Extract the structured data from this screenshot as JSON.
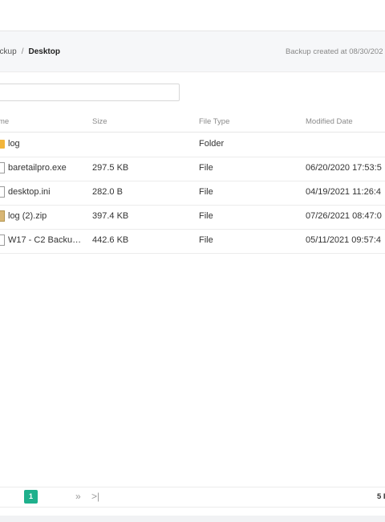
{
  "breadcrumb": {
    "parent": "ackup",
    "separator": "/",
    "current": "Desktop"
  },
  "backup_info": "Backup created at 08/30/202",
  "search": {
    "placeholder": "",
    "value": ""
  },
  "table": {
    "headers": {
      "name": "me",
      "size": "Size",
      "type": "File Type",
      "modified": "Modified Date"
    },
    "rows": [
      {
        "icon": "folder-icon",
        "name": "log",
        "size": "",
        "type": "Folder",
        "modified": ""
      },
      {
        "icon": "file-icon",
        "name": "baretailpro.exe",
        "size": "297.5 KB",
        "type": "File",
        "modified": "06/20/2020 17:53:5"
      },
      {
        "icon": "file-icon",
        "name": "desktop.ini",
        "size": "282.0 B",
        "type": "File",
        "modified": "04/19/2021 11:26:4"
      },
      {
        "icon": "zip-icon",
        "name": "log (2).zip",
        "size": "397.4 KB",
        "type": "File",
        "modified": "07/26/2021 08:47:0"
      },
      {
        "icon": "file-icon",
        "name": "W17 - C2 Backup…",
        "size": "442.6 KB",
        "type": "File",
        "modified": "05/11/2021 09:57:4"
      }
    ]
  },
  "pagination": {
    "current_page": "1",
    "next": "»",
    "last": ">|",
    "total": "5 I"
  },
  "colors": {
    "accent": "#1fb08c",
    "folder": "#f2b53b"
  }
}
